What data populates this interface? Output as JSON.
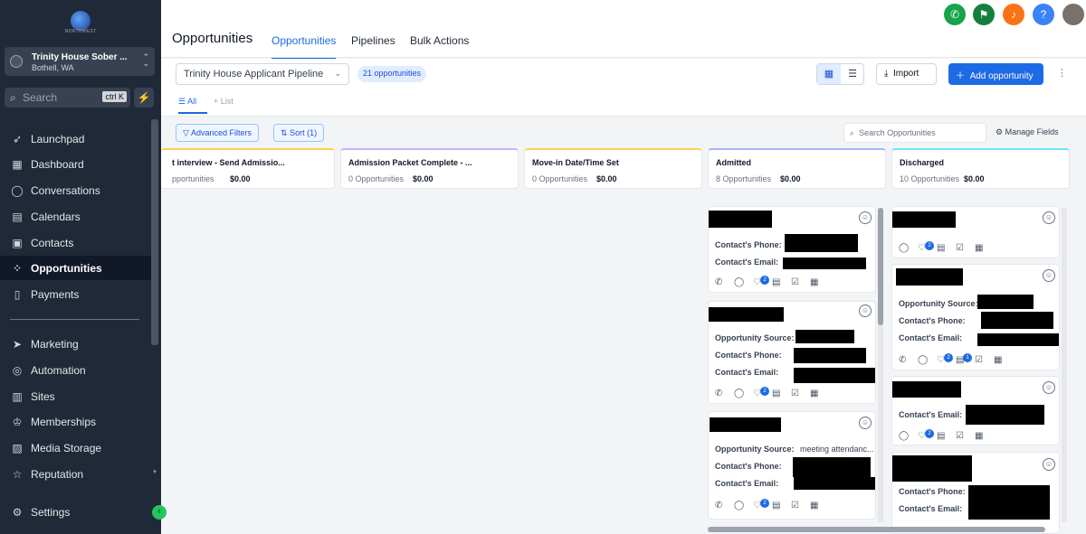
{
  "brand": {
    "logo_text": "NORTHWEST"
  },
  "account": {
    "name": "Trinity House Sober ...",
    "location": "Bothell, WA"
  },
  "search": {
    "placeholder": "Search",
    "shortcut": "ctrl K"
  },
  "nav": [
    {
      "label": "Launchpad",
      "icon": "rocket-icon"
    },
    {
      "label": "Dashboard",
      "icon": "dashboard-icon"
    },
    {
      "label": "Conversations",
      "icon": "chat-icon"
    },
    {
      "label": "Calendars",
      "icon": "calendar-icon"
    },
    {
      "label": "Contacts",
      "icon": "contacts-icon"
    },
    {
      "label": "Opportunities",
      "icon": "opportunities-icon",
      "active": true
    },
    {
      "label": "Payments",
      "icon": "payments-icon"
    },
    {
      "label": "Marketing",
      "icon": "send-icon"
    },
    {
      "label": "Automation",
      "icon": "automation-icon"
    },
    {
      "label": "Sites",
      "icon": "sites-icon"
    },
    {
      "label": "Memberships",
      "icon": "memberships-icon"
    },
    {
      "label": "Media Storage",
      "icon": "image-icon"
    },
    {
      "label": "Reputation",
      "icon": "star-icon"
    },
    {
      "label": "Settings",
      "icon": "gear-icon"
    }
  ],
  "header": {
    "title": "Opportunities",
    "tabs": [
      "Opportunities",
      "Pipelines",
      "Bulk Actions"
    ]
  },
  "toolbar": {
    "pipeline": "Trinity House Applicant Pipeline",
    "count": "21 opportunities",
    "import_label": "Import",
    "add_label": "Add opportunity",
    "subtabs": [
      "All",
      "List"
    ],
    "advanced_filters": "Advanced Filters",
    "sort": "Sort (1)",
    "search_placeholder": "Search Opportunities",
    "manage_fields": "Manage Fields"
  },
  "columns": [
    {
      "title": "t interview - Send Admissio...",
      "count": "pportunities",
      "value": "$0.00",
      "accent": "#fcd34d"
    },
    {
      "title": "Admission Packet Complete - ...",
      "count": "0 Opportunities",
      "value": "$0.00",
      "accent": "#c4b5fd"
    },
    {
      "title": "Move-in Date/Time Set",
      "count": "0 Opportunities",
      "value": "$0.00",
      "accent": "#fcd34d"
    },
    {
      "title": "Admitted",
      "count": "8 Opportunities",
      "value": "$0.00",
      "accent": "#a5b4fc"
    },
    {
      "title": "Discharged",
      "count": "10 Opportunities",
      "value": "$0.00",
      "accent": "#67e8f9"
    }
  ],
  "cards": {
    "labels": {
      "phone": "Contact's Phone:",
      "email": "Contact's Email:",
      "source": "Opportunity Source:"
    },
    "source_value": "meeting attendanc...",
    "badge": "2",
    "badge2": "1"
  },
  "colors": {
    "primary": "#1d6ae5",
    "sidebar": "#1f2937",
    "success": "#22c55e",
    "warning": "#f97316"
  }
}
